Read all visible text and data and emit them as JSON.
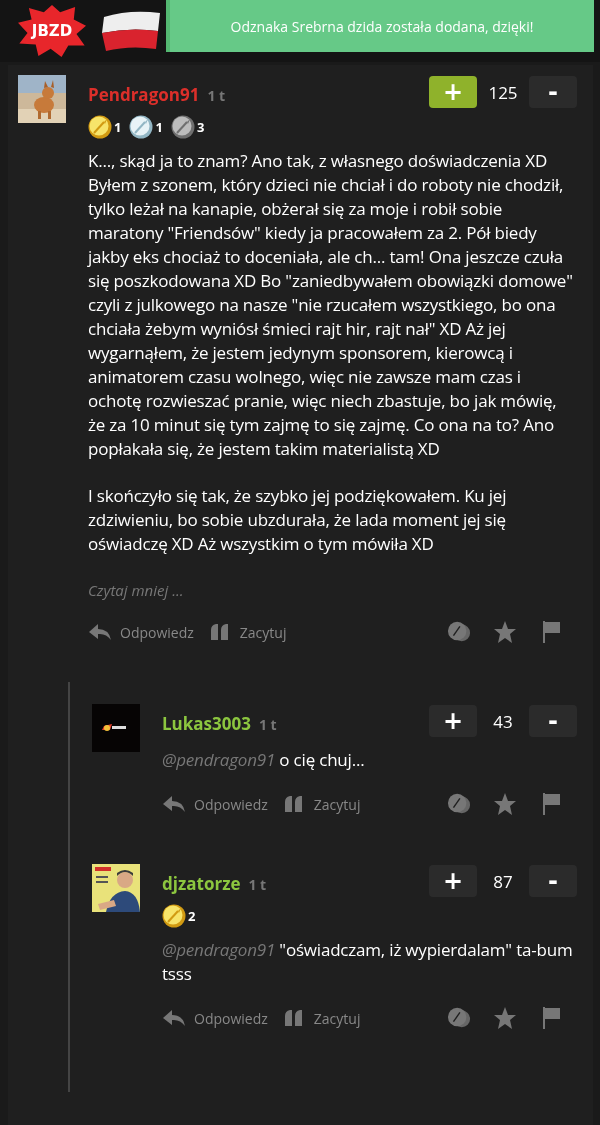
{
  "header": {
    "logo": "JBZD"
  },
  "toast": {
    "message": "Odznaka Srebrna dzida została dodana, dzięki!"
  },
  "comments": [
    {
      "author": "Pendragon91",
      "color": "#dc2f2a",
      "time": "1 t",
      "avatar": {
        "kind": "picture"
      },
      "upvoted": true,
      "score": "125",
      "up": "+",
      "down": "-",
      "badges": [
        {
          "kind": "gold",
          "count": "1"
        },
        {
          "kind": "silver",
          "count": "1"
        },
        {
          "kind": "stone",
          "count": "3"
        }
      ],
      "body": [
        {
          "text": "K..., skąd ja to znam? Ano tak, z własnego doświadczenia XD Byłem z szonem, który dzieci nie chciał i do roboty nie chodził, tylko leżał na kanapie, obżerał się za moje i robił sobie maratony \"Friendsów\" kiedy ja pracowałem za 2. Pół biedy jakby eks chociaż to doceniała, ale ch... tam! Ona jeszcze czuła się poszkodowana XD Bo \"zaniedbywałem obowiązki domowe\" czyli z julkowego na nasze \"nie rzucałem wszystkiego, bo ona chciała żebym wyniósł śmieci rajt hir, rajt nał\" XD Aż jej wygarnąłem, że jestem jedynym sponsorem, kierowcą i animatorem czasu wolnego, więc nie zawsze mam czas i ochotę rozwieszać pranie, więc niech zbastuje, bo jak mówię, że za 10 minut się tym zajmę to się zajmę. Co ona na to? Ano popłakała się, że jestem takim materialistą XD"
        },
        {
          "text": "I skończyło się tak, że szybko jej podziękowałem. Ku jej zdziwieniu, bo sobie ubzdurała, że lada moment jej się oświadczę XD Aż wszystkim o tym mówiła XD"
        }
      ],
      "read_less": "Czytaj mniej ...",
      "reply": "Odpowiedz",
      "quote": "Zacytuj",
      "replies": [
        {
          "author": "Lukas3003",
          "color": "#8cc63f",
          "time": "1 t",
          "avatar": {
            "kind": "picture"
          },
          "upvoted": false,
          "score": "43",
          "up": "+",
          "down": "-",
          "body": [
            {
              "mention": "@pendragon91",
              "text": "o cię chuj..."
            }
          ],
          "reply": "Odpowiedz",
          "quote": "Zacytuj"
        },
        {
          "author": "djzatorze",
          "color": "#8cc63f",
          "time": "1 t",
          "avatar": {
            "kind": "picture"
          },
          "upvoted": false,
          "score": "87",
          "up": "+",
          "down": "-",
          "badges": [
            {
              "kind": "gold",
              "count": "2"
            }
          ],
          "body": [
            {
              "mention": "@pendragon91",
              "text": "\"oświadczam, iż wypierdalam\" ta-bum tsss"
            }
          ],
          "reply": "Odpowiedz",
          "quote": "Zacytuj"
        }
      ]
    }
  ]
}
